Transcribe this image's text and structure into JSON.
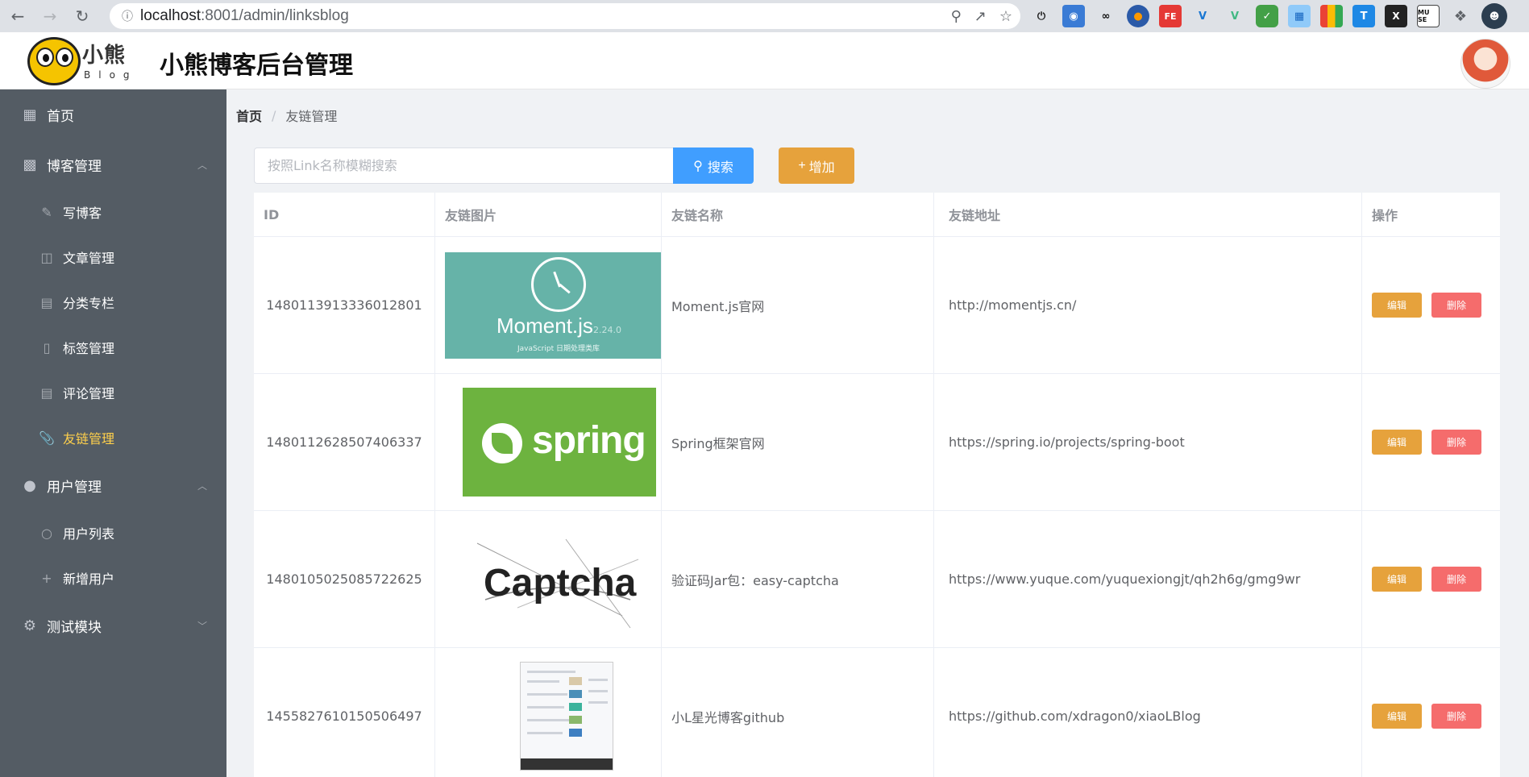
{
  "browser": {
    "url_host": "localhost",
    "url_rest": ":8001/admin/linksblog",
    "extensions": [
      "power-icon",
      "ext-1",
      "ext-2",
      "ext-3",
      "FE",
      "V",
      "V",
      "shield",
      "ext-4",
      "ext-5",
      "T",
      "X",
      "MU SE",
      "puzzle-icon"
    ]
  },
  "header": {
    "logo_title": "小熊",
    "logo_sub": "Blog",
    "app_title": "小熊博客后台管理"
  },
  "sidebar": {
    "items": [
      {
        "label": "首页",
        "icon": "dashboard-icon",
        "type": "item"
      },
      {
        "label": "博客管理",
        "icon": "blog-icon",
        "type": "group",
        "caret": "︿"
      },
      {
        "label": "写博客",
        "icon": "edit-icon",
        "type": "sub"
      },
      {
        "label": "文章管理",
        "icon": "notebook-icon",
        "type": "sub"
      },
      {
        "label": "分类专栏",
        "icon": "document-icon",
        "type": "sub"
      },
      {
        "label": "标签管理",
        "icon": "bookmark-icon",
        "type": "sub"
      },
      {
        "label": "评论管理",
        "icon": "tickets-icon",
        "type": "sub"
      },
      {
        "label": "友链管理",
        "icon": "paperclip-icon",
        "type": "sub",
        "active": true
      },
      {
        "label": "用户管理",
        "icon": "user-solid-icon",
        "type": "group",
        "caret": "︿"
      },
      {
        "label": "用户列表",
        "icon": "user-icon",
        "type": "sub"
      },
      {
        "label": "新增用户",
        "icon": "plus-icon",
        "type": "sub"
      },
      {
        "label": "测试模块",
        "icon": "setting-icon",
        "type": "group",
        "caret": "﹀"
      }
    ]
  },
  "breadcrumb": {
    "home": "首页",
    "separator": "/",
    "current": "友链管理"
  },
  "search": {
    "placeholder": "按照Link名称模糊搜索",
    "value": "",
    "search_label": "搜索",
    "add_label": "增加"
  },
  "table": {
    "headers": {
      "id": "ID",
      "image": "友链图片",
      "name": "友链名称",
      "url": "友链地址",
      "ops": "操作"
    },
    "edit_label": "编辑",
    "delete_label": "删除",
    "rows": [
      {
        "id": "1480113913336012801",
        "image": "moment",
        "name": "Moment.js官网",
        "url": "http://momentjs.cn/",
        "thumb": {
          "title": "Moment.js",
          "version": "2.24.0",
          "subtitle": "JavaScript 日期处理类库"
        }
      },
      {
        "id": "1480112628507406337",
        "image": "spring",
        "name": "Spring框架官网",
        "url": "https://spring.io/projects/spring-boot",
        "thumb": {
          "title": "spring"
        }
      },
      {
        "id": "1480105025085722625",
        "image": "captcha",
        "name": "验证码Jar包：easy-captcha",
        "url": "https://www.yuque.com/yuquexiongjt/qh2h6g/gmg9wr",
        "thumb": {
          "title": "Captcha"
        }
      },
      {
        "id": "1455827610150506497",
        "image": "github",
        "name": "小L星光博客github",
        "url": "https://github.com/xdragon0/xiaoLBlog",
        "thumb": {}
      }
    ]
  },
  "colors": {
    "sidebar_bg": "#545c64",
    "active_menu": "#ffd04b",
    "primary": "#409eff",
    "warning": "#e6a23c",
    "danger": "#f56c6c"
  }
}
